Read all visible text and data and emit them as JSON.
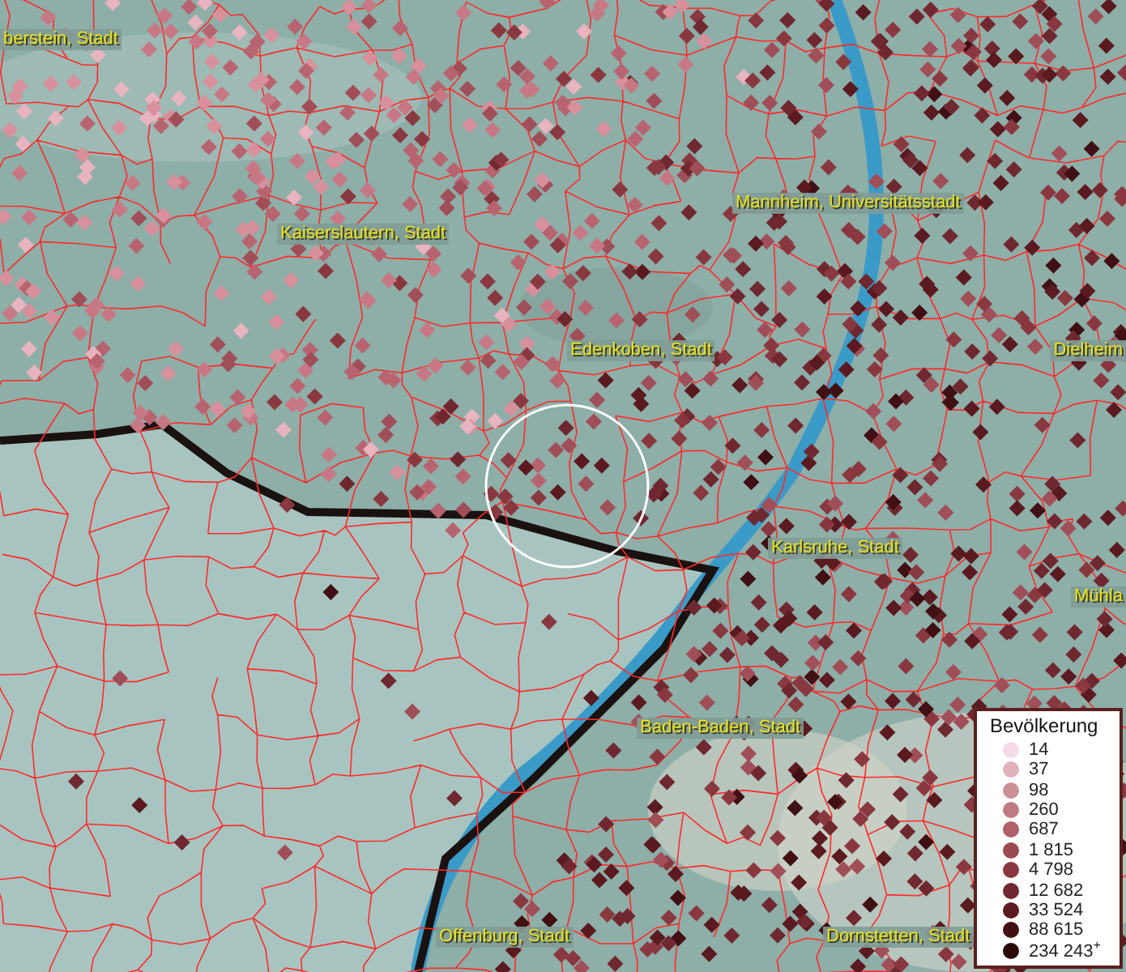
{
  "map": {
    "places": [
      {
        "name": "berstein, Stadt"
      },
      {
        "name": "Kaiserslautern, Stadt"
      },
      {
        "name": "Mannheim, Universitätsstadt"
      },
      {
        "name": "Edenkoben, Stadt"
      },
      {
        "name": "Dielheim"
      },
      {
        "name": "Karlsruhe, Stadt"
      },
      {
        "name": "Mühla"
      },
      {
        "name": "Baden-Baden, Stadt"
      },
      {
        "name": "Offenburg, Stadt"
      },
      {
        "name": "Dornstetten, Stadt"
      }
    ]
  },
  "legend": {
    "title": "Bevölkerung",
    "items": [
      {
        "label": "14",
        "color": "#f5dbe6"
      },
      {
        "label": "37",
        "color": "#e0b0bc"
      },
      {
        "label": "98",
        "color": "#cc9098"
      },
      {
        "label": "260",
        "color": "#bf7a84"
      },
      {
        "label": "687",
        "color": "#b0606a"
      },
      {
        "label": "1 815",
        "color": "#9c4a52"
      },
      {
        "label": "4 798",
        "color": "#8a3840"
      },
      {
        "label": "12 682",
        "color": "#702830"
      },
      {
        "label": "33 524",
        "color": "#5a1a20"
      },
      {
        "label": "88 615",
        "color": "#401014"
      },
      {
        "label": "234 243$^{+}$",
        "color": "#2a0808"
      }
    ]
  }
}
